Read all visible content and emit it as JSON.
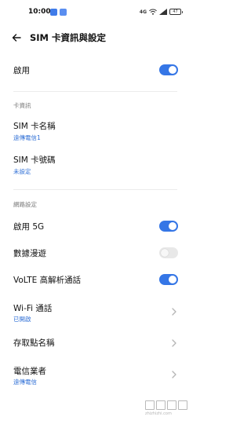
{
  "status_bar": {
    "time": "10:00",
    "network": "4G",
    "battery": "47"
  },
  "header": {
    "title": "SIM 卡資訊與設定"
  },
  "enable_row": {
    "label": "啟用",
    "state": true
  },
  "card_info": {
    "section_title": "卡資訊",
    "sim_name_label": "SIM 卡名稱",
    "sim_name_value": "遠傳電信1",
    "sim_number_label": "SIM 卡號碼",
    "sim_number_value": "未設定"
  },
  "network_settings": {
    "section_title": "網路設定",
    "enable_5g_label": "啟用 5G",
    "enable_5g_state": true,
    "data_roaming_label": "數據漫遊",
    "data_roaming_state": false,
    "volte_label": "VoLTE 高解析通話",
    "volte_state": true,
    "wifi_calling_label": "Wi-Fi 通話",
    "wifi_calling_value": "已開啟",
    "apn_label": "存取點名稱",
    "carrier_label": "電信業者",
    "carrier_value": "遠傳電信"
  },
  "watermark": {
    "text": "zhizhizhi.com"
  },
  "colors": {
    "accent": "#3576e6",
    "sublabel": "#2f6fd6",
    "section_title": "#7a7a7a"
  }
}
